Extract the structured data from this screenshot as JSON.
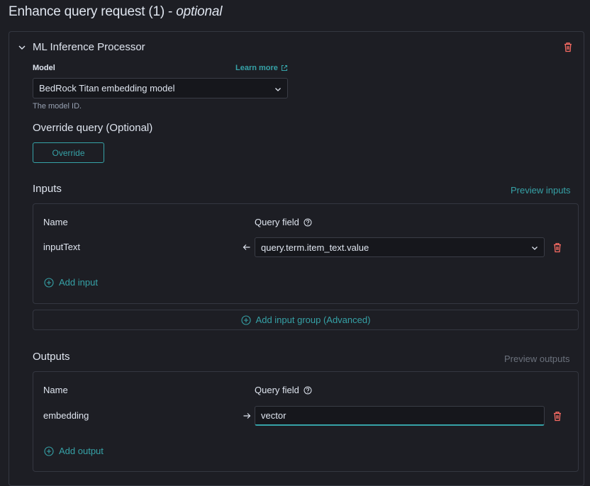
{
  "header": {
    "title_main": "Enhance query request (1) - ",
    "title_optional": "optional"
  },
  "processor": {
    "title": "ML Inference Processor",
    "model_label": "Model",
    "learn_more": "Learn more",
    "model_value": "BedRock Titan embedding model",
    "model_help": "The model ID.",
    "override_title": "Override query (Optional)",
    "override_button": "Override"
  },
  "inputs": {
    "title": "Inputs",
    "preview": "Preview inputs",
    "col_name": "Name",
    "col_field": "Query field",
    "rows": [
      {
        "name": "inputText",
        "field": "query.term.item_text.value"
      }
    ],
    "add_input": "Add input",
    "add_group": "Add input group (Advanced)"
  },
  "outputs": {
    "title": "Outputs",
    "preview": "Preview outputs",
    "col_name": "Name",
    "col_field": "Query field",
    "rows": [
      {
        "name": "embedding",
        "field": "vector"
      }
    ],
    "add_output": "Add output"
  },
  "colors": {
    "accent": "#36a2a7",
    "danger": "#f86b63",
    "background": "#1d1e24"
  }
}
